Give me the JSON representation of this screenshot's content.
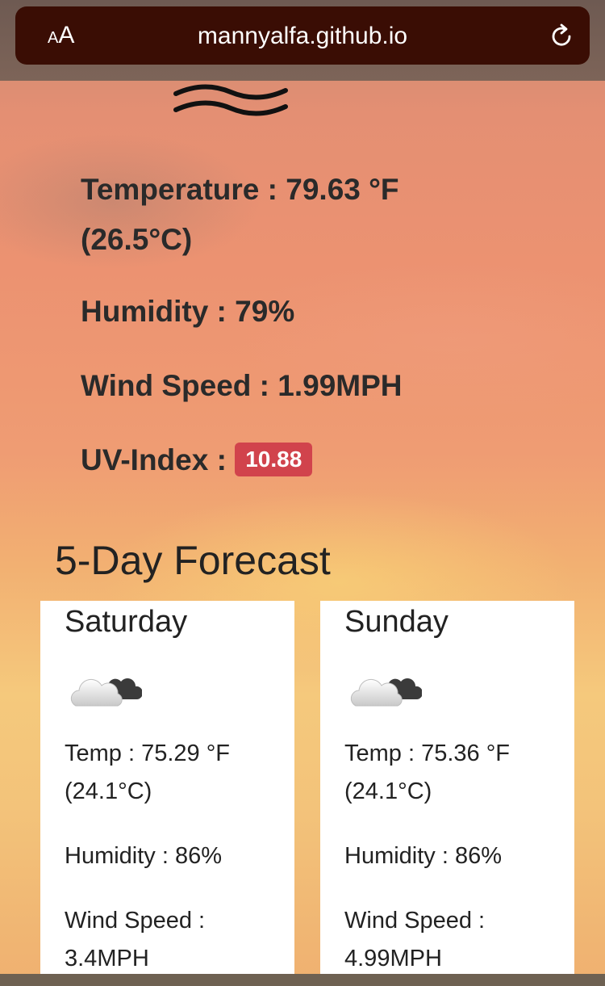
{
  "browser": {
    "text_size_label_small": "A",
    "text_size_label_large": "A",
    "url": "mannyalfa.github.io"
  },
  "current": {
    "temperature": "Temperature : 79.63 °F",
    "temperature_celsius": "(26.5°C)",
    "humidity": "Humidity : 79%",
    "wind_speed": "Wind Speed : 1.99MPH",
    "uv_label": "UV-Index :",
    "uv_value": "10.88"
  },
  "forecast": {
    "title": "5-Day Forecast",
    "days": [
      {
        "day": "Saturday",
        "icon": "partly-cloudy-icon",
        "temp": "Temp : 75.29 °F",
        "temp_celsius": "(24.1°C)",
        "humidity": "Humidity : 86%",
        "wind_label": "Wind Speed :",
        "wind_value": "3.4MPH"
      },
      {
        "day": "Sunday",
        "icon": "partly-cloudy-icon",
        "temp": "Temp : 75.36 °F",
        "temp_celsius": "(24.1°C)",
        "humidity": "Humidity : 86%",
        "wind_label": "Wind Speed :",
        "wind_value": "4.99MPH"
      }
    ]
  },
  "colors": {
    "uv_badge": "#d1434c",
    "url_bar": "#3a0d04",
    "card": "#ffffff"
  }
}
